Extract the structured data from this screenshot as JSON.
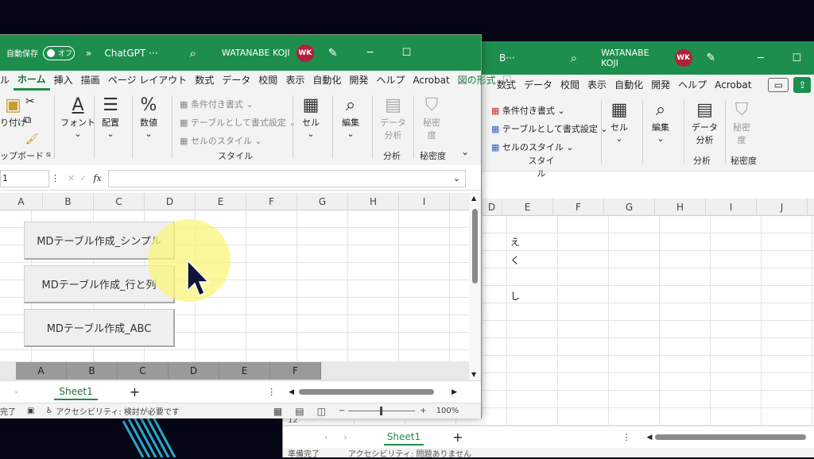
{
  "back_window": {
    "title": "B···",
    "user": "WATANABE KOJI",
    "user_initials": "WK",
    "tabs": [
      "数式",
      "データ",
      "校閲",
      "表示",
      "自動化",
      "開発",
      "ヘルプ",
      "Acrobat"
    ],
    "ribbon": {
      "cond_format": "条件付き書式",
      "table_format": "テーブルとして書式設定",
      "cell_style": "セルのスタイル",
      "style_group": "スタイル",
      "cell": "セル",
      "edit": "編集",
      "data_analysis": "データ\n分析",
      "analysis_group": "分析",
      "sensitivity": "秘密\n度",
      "sensitivity_group": "秘密度"
    },
    "columns": [
      "D",
      "E",
      "F",
      "G",
      "H",
      "I",
      "J"
    ],
    "cells": {
      "e1": "え",
      "e2": "く",
      "e3": "し"
    },
    "row_label": "12",
    "sheet_tab": "Sheet1",
    "status_ready": "準備完了",
    "status_access": "アクセシビリティ: 問題ありません"
  },
  "front_window": {
    "autosave": "自動保存",
    "autosave_state": "オフ",
    "title": "ChatGPT ···",
    "user": "WATANABE KOJI",
    "user_initials": "WK",
    "tabs": [
      "ル",
      "ホーム",
      "挿入",
      "描画",
      "ページ レイアウト",
      "数式",
      "データ",
      "校閲",
      "表示",
      "自動化",
      "開発",
      "ヘルプ",
      "Acrobat",
      "図の形式"
    ],
    "active_tab": "ホーム",
    "ribbon": {
      "paste": "り付け",
      "clipboard": "ップボード",
      "font": "フォント",
      "align": "配置",
      "number": "数値",
      "cond_format": "条件付き書式",
      "table_format": "テーブルとして書式設定",
      "cell_style": "セルのスタイル",
      "style_group": "スタイル",
      "cell": "セル",
      "edit": "編集",
      "data_analysis": "データ\n分析",
      "analysis_group": "分析",
      "sensitivity": "秘密\n度",
      "sensitivity_group": "秘密度"
    },
    "name_box": "1",
    "fx": "fx",
    "columns": [
      "A",
      "B",
      "C",
      "D",
      "E",
      "F",
      "G",
      "H",
      "I"
    ],
    "frozen_columns": [
      "A",
      "B",
      "C",
      "D",
      "E",
      "F"
    ],
    "macro_buttons": [
      "MDテーブル作成_シンプル",
      "MDテーブル作成_行と列",
      "MDテーブル作成_ABC"
    ],
    "sheet_tab": "Sheet1",
    "status_ready": "完了",
    "status_access": "アクセシビリティ: 検討が必要です",
    "zoom": "100%"
  },
  "colors": {
    "excel_green": "#1e8e4e",
    "avatar": "#b1203a",
    "highlight": "#f8f578"
  }
}
